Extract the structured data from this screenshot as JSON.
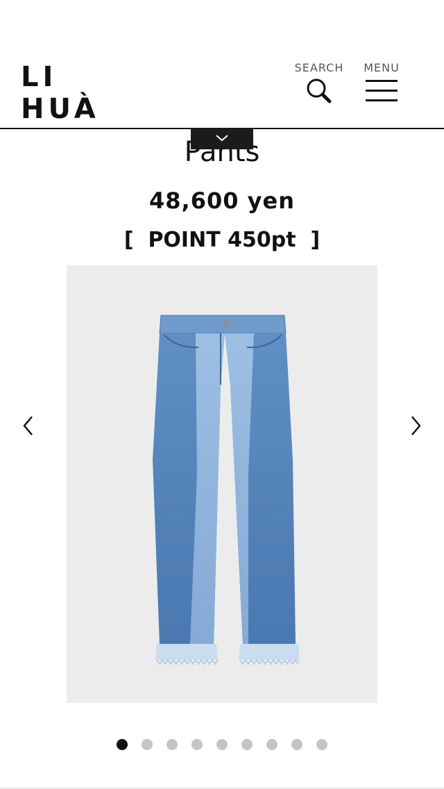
{
  "brand": {
    "logo_text": "LI HUÀ"
  },
  "header": {
    "search_label": "SEARCH",
    "menu_label": "MENU"
  },
  "product": {
    "title": "Pants",
    "price": "48,600 yen",
    "points": "[  POINT 450pt  ]",
    "image_icon": "denim-pants-image"
  },
  "carousel": {
    "total_slides": 9,
    "active_index": 0,
    "prev_icon": "chevron-left-icon",
    "next_icon": "chevron-right-icon"
  },
  "colors": {
    "text": "#111111",
    "dot_active": "#111111",
    "dot_inactive": "#c4c4c4",
    "image_bg": "#ececec",
    "collapse_tab": "#1b1b1b"
  }
}
